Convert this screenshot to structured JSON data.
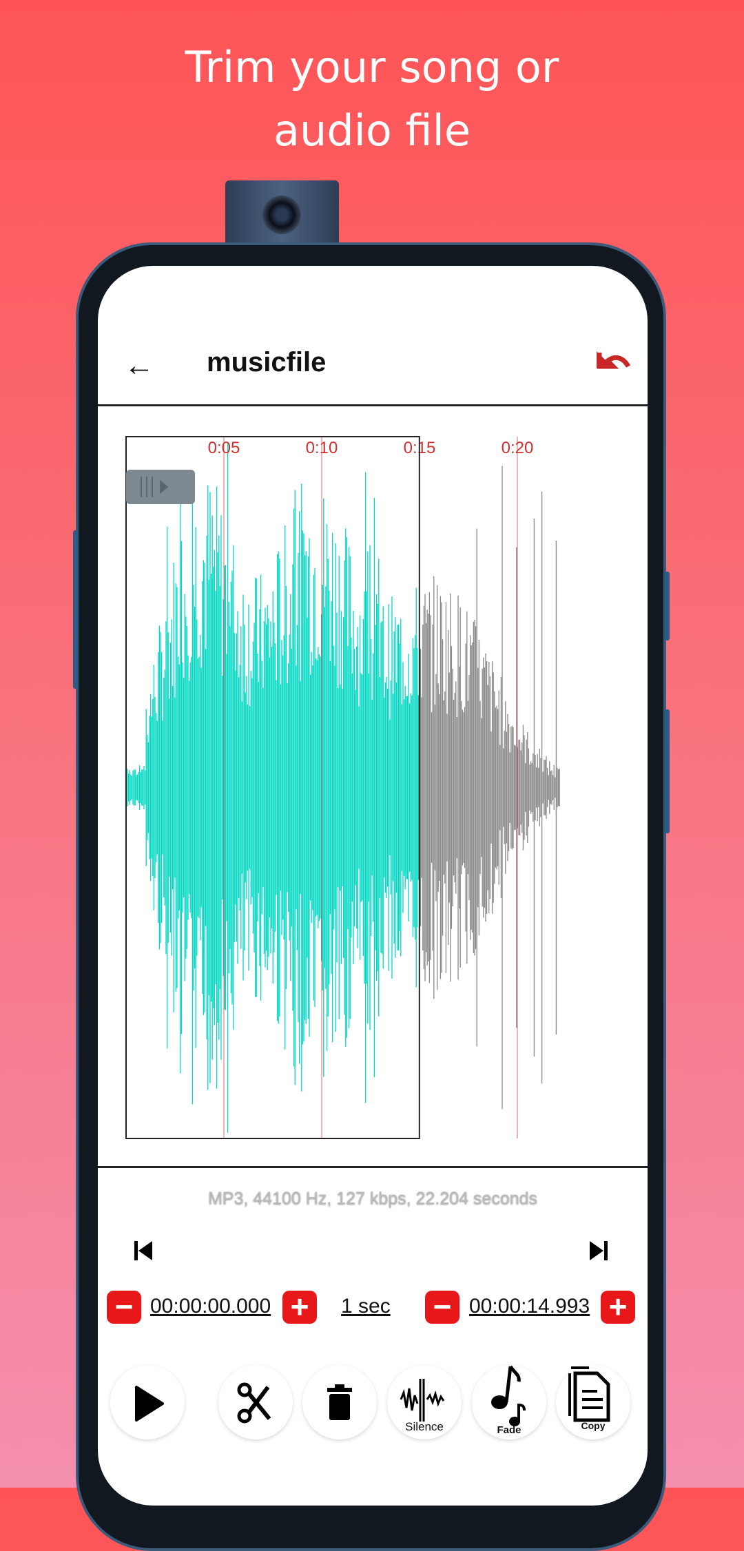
{
  "headline": {
    "line1": "Trim your song or",
    "line2": "audio file"
  },
  "toolbar": {
    "title": "musicfile",
    "back_icon": "arrow-left-icon",
    "undo_icon": "undo-icon",
    "undo_color": "#c62828"
  },
  "waveform": {
    "ticks": [
      "0:05",
      "0:10",
      "0:15",
      "0:20"
    ],
    "duration_seconds": 22.204,
    "selection_start_seconds": 0,
    "selection_end_seconds": 14.993,
    "selected_color": "#00d8c4",
    "unselected_color": "#888888",
    "tick_color": "#d32f2f"
  },
  "info": "MP3, 44100 Hz, 127 kbps, 22.204 seconds",
  "trim": {
    "start": "00:00:00.000",
    "step": "1 sec",
    "end": "00:00:14.993",
    "accent": "#e8171a"
  },
  "actions": {
    "silence": "Silence",
    "fade": "Fade",
    "copy": "Copy"
  }
}
